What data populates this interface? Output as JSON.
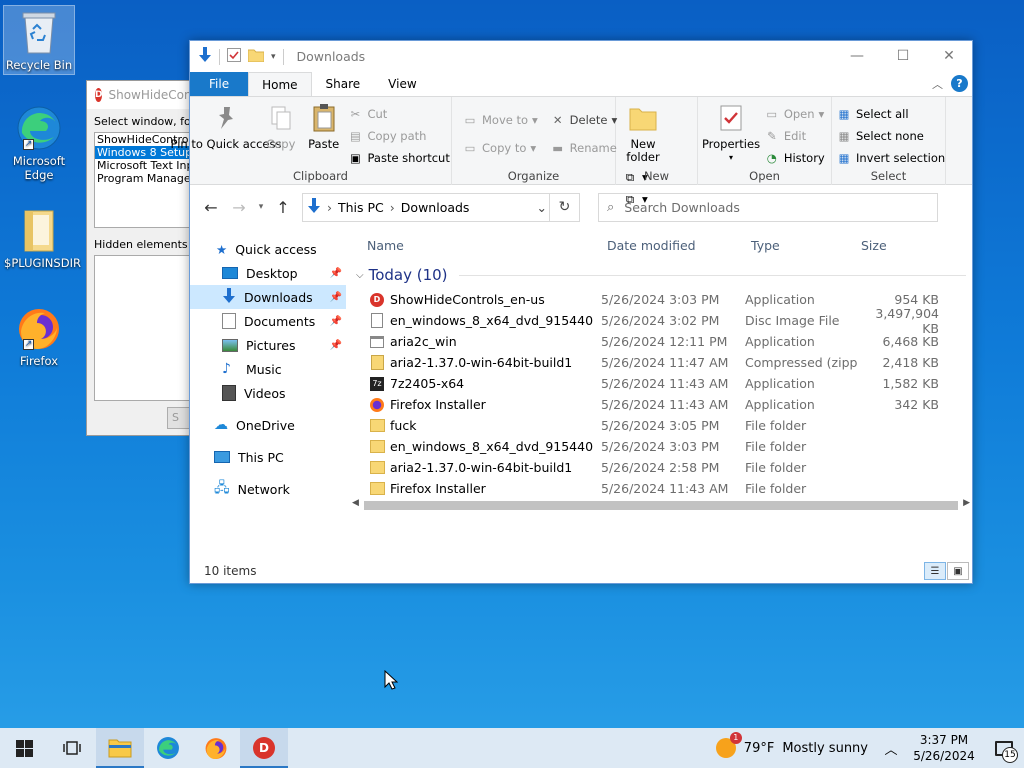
{
  "desktop": {
    "icons": [
      {
        "label": "Recycle Bin"
      },
      {
        "label": "Microsoft Edge"
      },
      {
        "label": "$PLUGINSDIR"
      },
      {
        "label": "Firefox"
      }
    ]
  },
  "showhide": {
    "title": "ShowHideControls",
    "select_label": "Select window, for e",
    "windows": [
      "ShowHideControls",
      "Windows 8 Setup",
      "Microsoft Text Input",
      "Program Manager"
    ],
    "selected_index": 1,
    "hidden_label": "Hidden elements are",
    "button_label": "S"
  },
  "explorer": {
    "title": "Downloads",
    "tabs": {
      "file": "File",
      "home": "Home",
      "share": "Share",
      "view": "View"
    },
    "ribbon": {
      "clipboard": {
        "pin": "Pin to Quick access",
        "copy": "Copy",
        "paste": "Paste",
        "cut": "Cut",
        "copy_path": "Copy path",
        "paste_shortcut": "Paste shortcut",
        "label": "Clipboard"
      },
      "organize": {
        "move_to": "Move to",
        "copy_to": "Copy to",
        "delete": "Delete",
        "rename": "Rename",
        "label": "Organize"
      },
      "new": {
        "new_folder": "New folder",
        "label": "New"
      },
      "open": {
        "properties": "Properties",
        "open": "Open",
        "edit": "Edit",
        "history": "History",
        "label": "Open"
      },
      "select": {
        "select_all": "Select all",
        "select_none": "Select none",
        "invert": "Invert selection",
        "label": "Select"
      }
    },
    "address": {
      "crumbs": [
        "This PC",
        "Downloads"
      ]
    },
    "search_placeholder": "Search Downloads",
    "nav": [
      {
        "label": "Quick access",
        "icon": "star-icon"
      },
      {
        "label": "Desktop",
        "icon": "desktop-icon",
        "pinned": true
      },
      {
        "label": "Downloads",
        "icon": "download-icon",
        "pinned": true,
        "selected": true
      },
      {
        "label": "Documents",
        "icon": "documents-icon",
        "pinned": true
      },
      {
        "label": "Pictures",
        "icon": "pictures-icon",
        "pinned": true
      },
      {
        "label": "Music",
        "icon": "music-icon"
      },
      {
        "label": "Videos",
        "icon": "videos-icon"
      },
      {
        "label": "OneDrive",
        "icon": "cloud-icon"
      },
      {
        "label": "This PC",
        "icon": "pc-icon"
      },
      {
        "label": "Network",
        "icon": "network-icon"
      }
    ],
    "columns": {
      "name": "Name",
      "date": "Date modified",
      "type": "Type",
      "size": "Size"
    },
    "group": "Today (10)",
    "files": [
      {
        "name": "ShowHideControls_en-us",
        "date": "5/26/2024 3:03 PM",
        "type": "Application",
        "size": "954 KB",
        "icon": "app-red"
      },
      {
        "name": "en_windows_8_x64_dvd_915440",
        "date": "5/26/2024 3:02 PM",
        "type": "Disc Image File",
        "size": "3,497,904 KB",
        "icon": "disc"
      },
      {
        "name": "aria2c_win",
        "date": "5/26/2024 12:11 PM",
        "type": "Application",
        "size": "6,468 KB",
        "icon": "app"
      },
      {
        "name": "aria2-1.37.0-win-64bit-build1",
        "date": "5/26/2024 11:47 AM",
        "type": "Compressed (zipp...",
        "size": "2,418 KB",
        "icon": "zip"
      },
      {
        "name": "7z2405-x64",
        "date": "5/26/2024 11:43 AM",
        "type": "Application",
        "size": "1,582 KB",
        "icon": "7z"
      },
      {
        "name": "Firefox Installer",
        "date": "5/26/2024 11:43 AM",
        "type": "Application",
        "size": "342 KB",
        "icon": "firefox"
      },
      {
        "name": "fuck",
        "date": "5/26/2024 3:05 PM",
        "type": "File folder",
        "size": "",
        "icon": "folder"
      },
      {
        "name": "en_windows_8_x64_dvd_915440",
        "date": "5/26/2024 3:03 PM",
        "type": "File folder",
        "size": "",
        "icon": "folder"
      },
      {
        "name": "aria2-1.37.0-win-64bit-build1",
        "date": "5/26/2024 2:58 PM",
        "type": "File folder",
        "size": "",
        "icon": "folder"
      },
      {
        "name": "Firefox Installer",
        "date": "5/26/2024 11:43 AM",
        "type": "File folder",
        "size": "",
        "icon": "folder"
      }
    ],
    "status": "10 items"
  },
  "taskbar": {
    "weather_temp": "79°F",
    "weather_desc": "Mostly sunny",
    "time": "3:37 PM",
    "date": "5/26/2024",
    "notification_count": "15",
    "weather_badge": "1"
  }
}
